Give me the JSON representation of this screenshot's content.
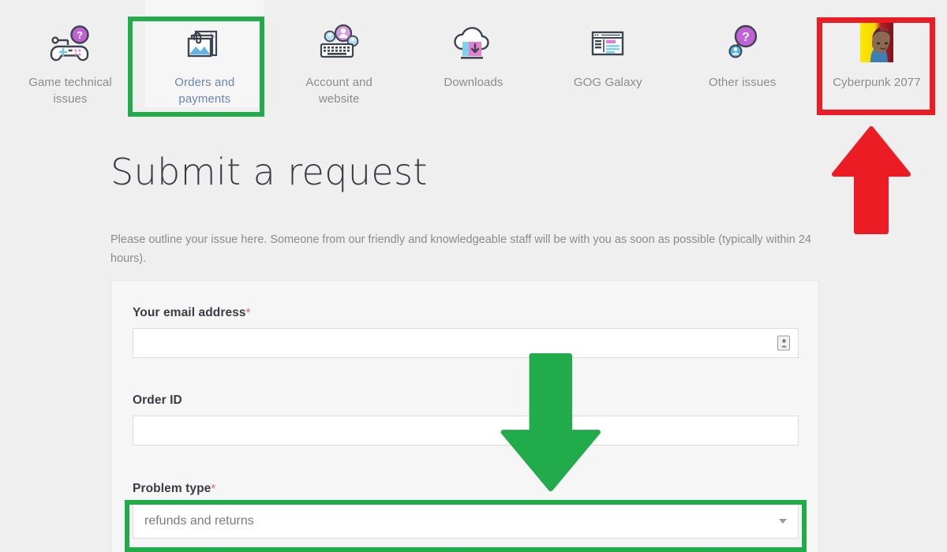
{
  "nav": {
    "items": [
      {
        "label": "Game technical issues",
        "icon": "gamepad-question-icon",
        "active": false
      },
      {
        "label": "Orders and payments",
        "icon": "documents-image-icon",
        "active": true
      },
      {
        "label": "Account and website",
        "icon": "keyboard-account-icon",
        "active": false
      },
      {
        "label": "Downloads",
        "icon": "cloud-download-icon",
        "active": false
      },
      {
        "label": "GOG Galaxy",
        "icon": "browser-window-icon",
        "active": false
      },
      {
        "label": "Other issues",
        "icon": "question-magnifier-icon",
        "active": false
      },
      {
        "label": "Cyberpunk 2077",
        "icon": "cyberpunk-thumbnail-icon",
        "active": false
      }
    ]
  },
  "main": {
    "title": "Submit a request",
    "description": "Please outline your issue here. Someone from our friendly and knowledgeable staff will be with you as soon as possible (typically within 24 hours)."
  },
  "form": {
    "email": {
      "label": "Your email address",
      "required_marker": "*",
      "value": "",
      "placeholder": ""
    },
    "order_id": {
      "label": "Order ID",
      "required_marker": "",
      "value": "",
      "placeholder": ""
    },
    "problem_type": {
      "label": "Problem type",
      "required_marker": "*",
      "selected": "refunds and returns",
      "caret": "chevron-down-icon"
    }
  },
  "annotations": {
    "green_box_nav": "Orders and payments",
    "red_box_nav": "Cyberpunk 2077",
    "green_box_field": "Problem type",
    "green_arrow": "down-arrow",
    "red_arrow": "up-arrow",
    "colors": {
      "green": "#22ab4b",
      "red": "#ec1c24",
      "accent_link": "#6b86b3",
      "required": "#e8645e",
      "page_bg": "#efefef",
      "card_bg": "#f6f6f6"
    }
  }
}
